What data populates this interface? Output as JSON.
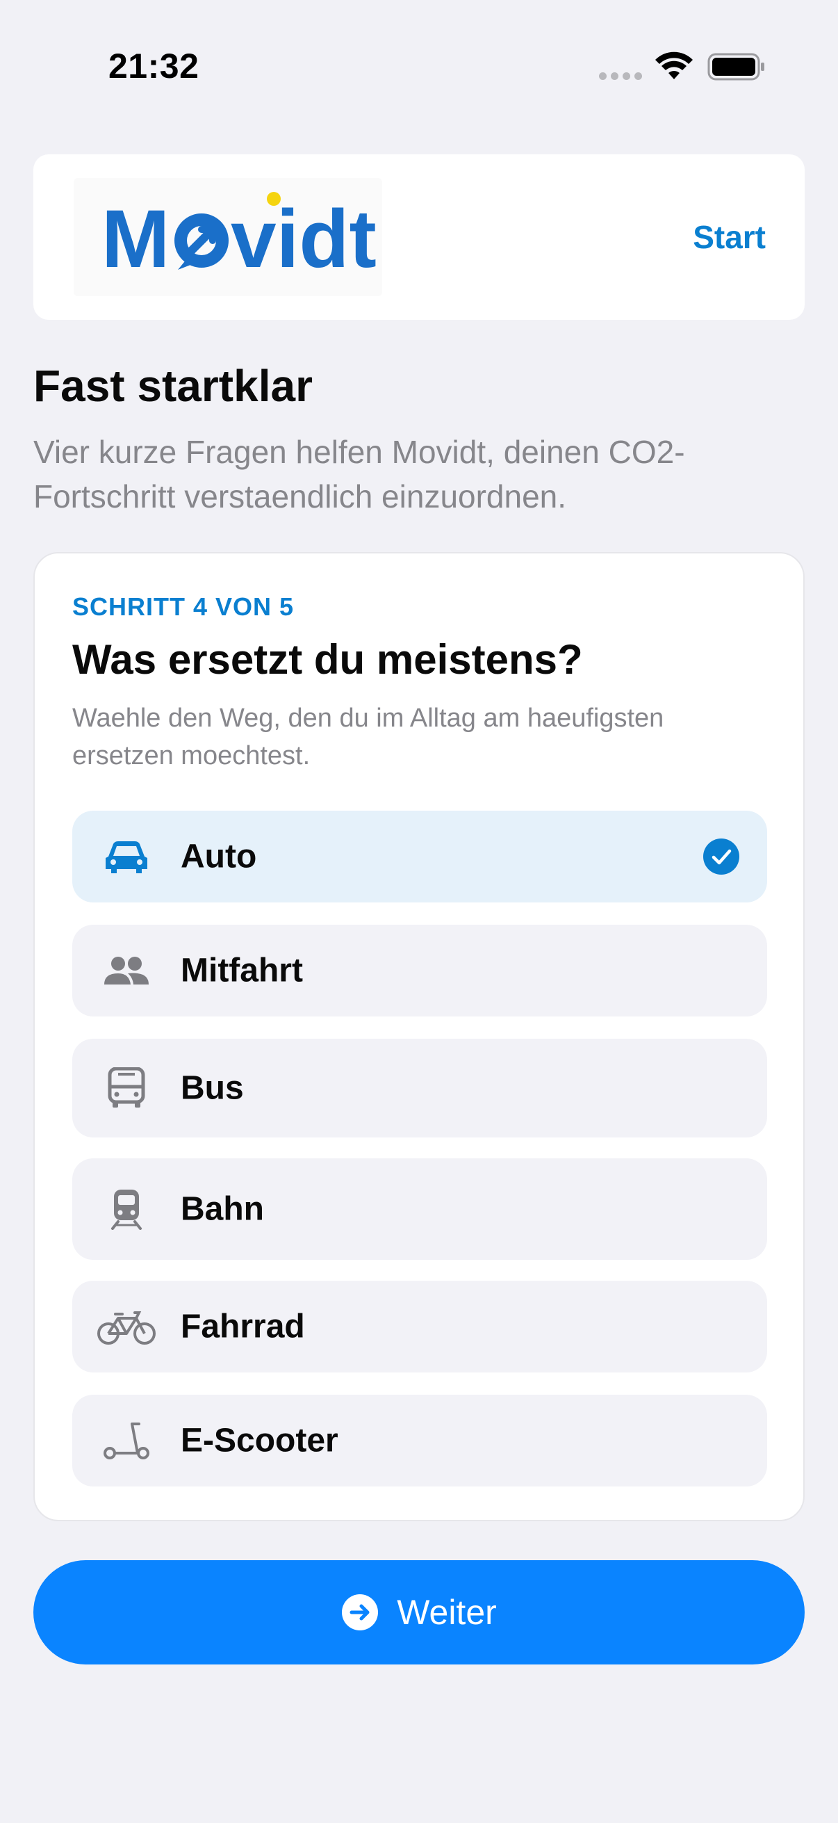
{
  "status_bar": {
    "time": "21:32"
  },
  "header": {
    "logo_text": "Movidt",
    "start_label": "Start"
  },
  "intro": {
    "title": "Fast startklar",
    "subtitle": "Vier kurze Fragen helfen Movidt, deinen CO2-Fortschritt verstaendlich einzuordnen."
  },
  "question": {
    "step_label": "SCHRITT 4 VON 5",
    "title": "Was ersetzt du meistens?",
    "hint": "Waehle den Weg, den du im Alltag am haeufigsten ersetzen moechtest.",
    "options": [
      {
        "label": "Auto",
        "icon": "car-icon",
        "selected": true
      },
      {
        "label": "Mitfahrt",
        "icon": "people-icon",
        "selected": false
      },
      {
        "label": "Bus",
        "icon": "bus-icon",
        "selected": false
      },
      {
        "label": "Bahn",
        "icon": "train-icon",
        "selected": false
      },
      {
        "label": "Fahrrad",
        "icon": "bicycle-icon",
        "selected": false
      },
      {
        "label": "E-Scooter",
        "icon": "scooter-icon",
        "selected": false
      }
    ]
  },
  "continue_button": {
    "label": "Weiter",
    "icon": "arrow-right-circle-icon"
  },
  "colors": {
    "accent": "#0a84ff",
    "brand": "#1a6fc9",
    "brand_dot": "#f5d40f",
    "selected_bg": "#e5f1fa",
    "option_bg": "#f2f2f7",
    "page_bg": "#f1f1f6"
  }
}
